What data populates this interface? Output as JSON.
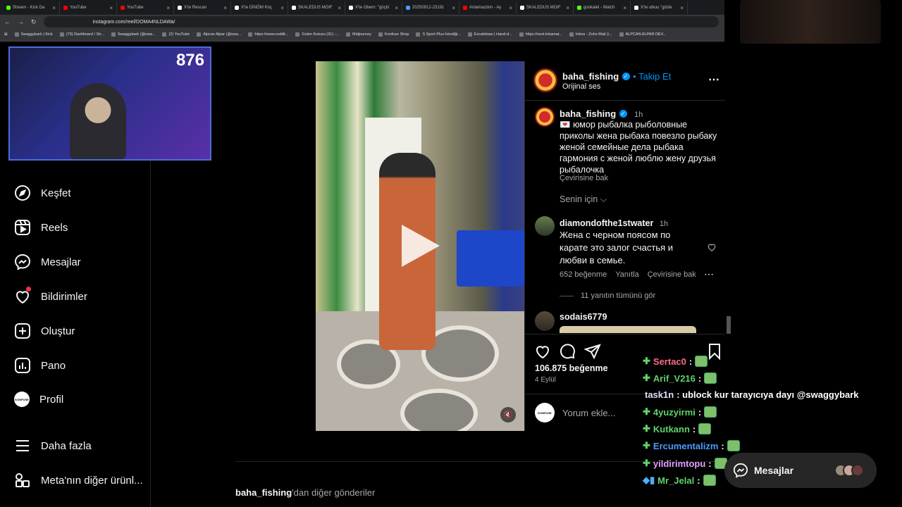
{
  "browser": {
    "tabs": [
      {
        "label": "Stream - Kick Da",
        "color": "#53fc18"
      },
      {
        "label": "YouTube",
        "color": "#ff0000"
      },
      {
        "label": "YouTube",
        "color": "#ff0000"
      },
      {
        "label": "X'te Rescan",
        "color": "#ffffff"
      },
      {
        "label": "X'te DİNÖM Küç",
        "color": "#ffffff"
      },
      {
        "label": "SKALEDUS MOIF",
        "color": "#ffffff"
      },
      {
        "label": "X'te Obern: \"güçlü",
        "color": "#ffffff"
      },
      {
        "label": "20250912-23191",
        "color": "#4a9bff"
      },
      {
        "label": "Anlamazdım - Ay",
        "color": "#ff0000"
      },
      {
        "label": "SKALEDUS MOIF",
        "color": "#ffffff"
      },
      {
        "label": "gookalel - Watch",
        "color": "#53fc18"
      },
      {
        "label": "X'te utkuu \"gözle",
        "color": "#ffffff"
      }
    ],
    "url": "instagram.com/reel/DOMA4NLDAWa/",
    "bookmarks": [
      "Swaggybark | Kick",
      "(79) Dashboard / Str...",
      "Swaggybark (@swa...",
      "(2) YouTube",
      "Alpcan Alpar (@swa...",
      "https://www.reddit...",
      "Gelen Kutusu (31) -...",
      "Midjourney",
      "Konfuse Shop",
      "S Sport Plus-İstediği...",
      "Excalidraw | Hand-d...",
      "https://next.inkamat...",
      "Inbox - Zoho Mail (i...",
      "ALPCAN ALPAR DEV..."
    ]
  },
  "webcam": {
    "viewer_count": "876"
  },
  "sidebar": {
    "items": [
      {
        "label": "Keşfet",
        "icon": "compass-icon"
      },
      {
        "label": "Reels",
        "icon": "reels-icon"
      },
      {
        "label": "Mesajlar",
        "icon": "messenger-icon"
      },
      {
        "label": "Bildirimler",
        "icon": "heart-icon"
      },
      {
        "label": "Oluştur",
        "icon": "plus-square-icon"
      },
      {
        "label": "Pano",
        "icon": "dashboard-icon"
      },
      {
        "label": "Profil",
        "icon": "profile-avatar"
      },
      {
        "label": "Daha fazla",
        "icon": "menu-icon"
      },
      {
        "label": "Meta'nın diğer ürünl...",
        "icon": "meta-apps-icon"
      }
    ],
    "profile_avatar_text": "KONFUSE"
  },
  "post": {
    "username": "baha_fishing",
    "follow_label": "• Takip Et",
    "audio": "Orijinal ses",
    "caption_username": "baha_fishing",
    "caption_time": "1h",
    "caption_emoji": "💌",
    "caption": "юмор рыбалка рыболовные приколы жена рыбака повезло рыбаку женой семейные дела рыбака гармония с женой люблю жену друзья рыбалочка",
    "translate_label": "Çevirisine bak",
    "for_you_label": "Senin için",
    "comments": [
      {
        "username": "diamondofthe1stwater",
        "time": "1h",
        "text": "Жена с черном поясом по карате это залог счастья и любви в семье.",
        "likes": "652 beğenme",
        "reply_label": "Yanıtla",
        "translate_label": "Çevirisine bak",
        "view_replies": "11 yanıtın tümünü gör"
      },
      {
        "username": "sodais6779"
      }
    ],
    "like_count": "106.875 beğenme",
    "date": "4 Eylül",
    "comment_placeholder": "Yorum ekle...",
    "commenter_avatar_text": "KONFUSE"
  },
  "more_posts": {
    "username": "baha_fishing",
    "suffix": "'dan diğer gönderiler"
  },
  "chat": [
    {
      "user": "Sertac0",
      "color": "#ff6b8a",
      "text": ":",
      "badge": "plus"
    },
    {
      "user": "Arif_V216",
      "color": "#5fd36a",
      "text": ":",
      "badge": "plus"
    },
    {
      "user": "task1n",
      "color": "#e0e0ff",
      "text": ": ublock kur tarayıcıya dayı @swaggybark",
      "badge": ""
    },
    {
      "user": "4yuzyirmi",
      "color": "#5fd36a",
      "text": ":",
      "badge": "plus"
    },
    {
      "user": "Kutkann",
      "color": "#5fd36a",
      "text": ":",
      "badge": "plus"
    },
    {
      "user": "Ercumentalizm",
      "color": "#4a9bff",
      "text": ":",
      "badge": "plus"
    },
    {
      "user": "yildirimtopu",
      "color": "#e0a0ff",
      "text": ":",
      "badge": "plus"
    },
    {
      "user": "Mr_Jelal",
      "color": "#5fd36a",
      "text": ":",
      "badge": "gem"
    }
  ],
  "messages_pill": {
    "label": "Mesajlar"
  }
}
